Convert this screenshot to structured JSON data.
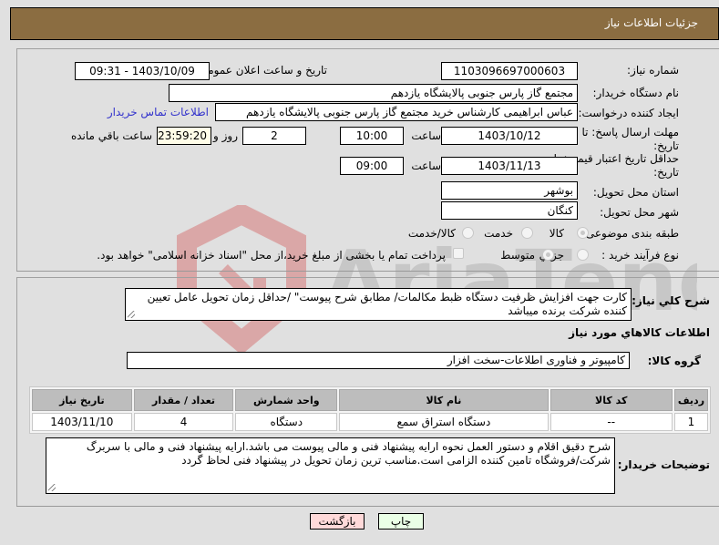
{
  "header": {
    "title": "جزئیات اطلاعات نیاز"
  },
  "form": {
    "need_number": {
      "label": "شماره نیاز:",
      "value": "1103096697000603"
    },
    "announce_datetime": {
      "label": "تاریخ و ساعت اعلان عمومی:",
      "value": "1403/10/09 - 09:31"
    },
    "buyer_org": {
      "label": "نام دستگاه خریدار:",
      "value": "مجتمع گاز پارس جنوبی  پالایشگاه یازدهم"
    },
    "requester": {
      "label": "ایجاد کننده درخواست:",
      "value": "عباس ابراهیمی کارشناس خرید مجتمع گاز پارس جنوبی  پالایشگاه یازدهم"
    },
    "contact_link": "اطلاعات تماس خریدار",
    "reply_deadline": {
      "label": "مهلت ارسال پاسخ: تا تاریخ:",
      "date": "1403/10/12",
      "time_label": "ساعت",
      "time": "10:00",
      "days": "2",
      "days_label": "روز و",
      "remaining": "23:59:20",
      "remaining_label": "ساعت باقي مانده"
    },
    "price_validity": {
      "label": "حداقل تاریخ اعتبار قیمت: تا تاریخ:",
      "date": "1403/11/13",
      "time_label": "ساعت",
      "time": "09:00"
    },
    "province": {
      "label": "استان محل تحویل:",
      "value": "بوشهر"
    },
    "city": {
      "label": "شهر محل تحویل:",
      "value": "کنگان"
    },
    "category": {
      "label": "طبقه بندی موضوعی:",
      "options": [
        "کالا",
        "خدمت",
        "کالا/خدمت"
      ],
      "selected": "کالا"
    },
    "purchase_type": {
      "label": "نوع فرآیند خرید :",
      "options": [
        "جزيي",
        "متوسط"
      ],
      "selected": "متوسط",
      "checkbox_label": "پرداخت تمام یا بخشی از مبلغ خرید،از محل \"اسناد خزانه اسلامی\" خواهد بود.",
      "checkbox_checked": false
    }
  },
  "description": {
    "label": "شرح كلي نياز:",
    "value": "کارت جهت افزایش ظرفیت دستگاه ظبط مکالمات/ مطابق شرح پیوست\" /حداقل زمان تحویل عامل تعیین کننده شرکت برنده میباشد"
  },
  "goods_section_title": "اطلاعات كالاهاي مورد نياز",
  "goods_group": {
    "label": "گروه کالا:",
    "value": "کامپیوتر و فناوری اطلاعات-سخت افزار"
  },
  "items_table": {
    "headers": [
      "ردیف",
      "کد کالا",
      "نام کالا",
      "واحد شمارش",
      "تعداد / مقدار",
      "تاریخ نیاز"
    ],
    "rows": [
      [
        "1",
        "--",
        "دستگاه استراق سمع",
        "دستگاه",
        "4",
        "1403/11/10"
      ]
    ]
  },
  "buyer_notes": {
    "label": "توضیحات خریدار:",
    "value": "شرح دقیق اقلام و دستور العمل نحوه ارایه پیشنهاد فنی و مالی پیوست می باشد.ارایه پیشنهاد فنی و مالی با سربرگ شرکت/فروشگاه تامین کننده الزامی است.مناسب ترین زمان تحویل در پیشنهاد فنی لحاظ گردد"
  },
  "buttons": {
    "print": "چاپ",
    "back": "بازگشت"
  },
  "watermark": {
    "text": "AriaTender.net",
    "colors": {
      "logo": "#d04040",
      "text": "#9a9a9a"
    }
  }
}
